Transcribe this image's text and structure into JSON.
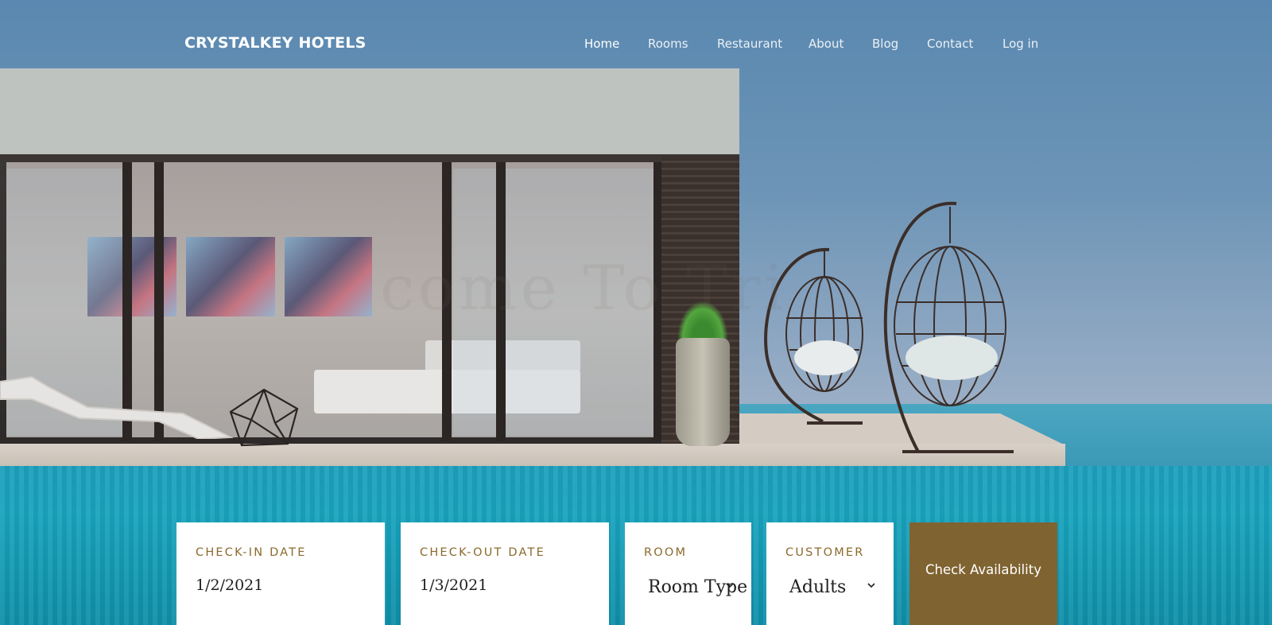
{
  "brand": {
    "name": "CRYSTALKEY HOTELS"
  },
  "nav": {
    "items": [
      {
        "label": "Home",
        "active": true
      },
      {
        "label": "Rooms",
        "active": false
      },
      {
        "label": "Restaurant",
        "active": false
      },
      {
        "label": "About",
        "active": false
      },
      {
        "label": "Blog",
        "active": false
      },
      {
        "label": "Contact",
        "active": false
      },
      {
        "label": "Log in",
        "active": false
      }
    ]
  },
  "hero": {
    "faint_text": "come To Tri"
  },
  "booking": {
    "checkin": {
      "label": "CHECK-IN DATE",
      "value": "1/2/2021"
    },
    "checkout": {
      "label": "CHECK-OUT DATE",
      "value": "1/3/2021"
    },
    "room": {
      "label": "ROOM",
      "value": "Room Type",
      "icon": "chevron-down-icon"
    },
    "customer": {
      "label": "CUSTOMER",
      "value": "Adults",
      "icon": "chevron-down-icon"
    },
    "submit_label": "Check Availability"
  },
  "colors": {
    "accent": "#7f6331",
    "label_text": "#8b6a2c",
    "nav_text": "#ffffff"
  }
}
